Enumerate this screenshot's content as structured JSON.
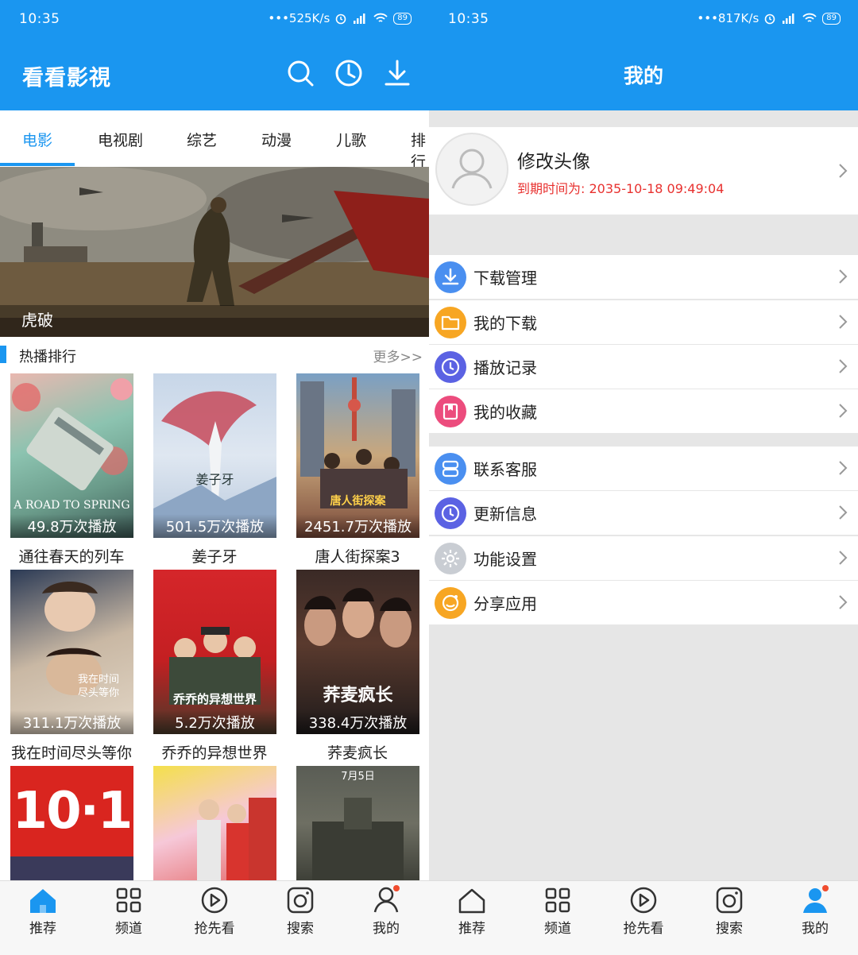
{
  "left": {
    "status": {
      "time": "10:35",
      "speed": "525K/s",
      "battery": "89"
    },
    "app_title": "看看影視",
    "tabs": [
      "电影",
      "电视剧",
      "综艺",
      "动漫",
      "儿歌",
      "排行"
    ],
    "active_tab": "电影",
    "banner": {
      "caption": "虎破"
    },
    "section": {
      "title": "热播排行",
      "more": "更多>>"
    },
    "posters": [
      {
        "title": "通往春天的列车",
        "count": "49.8万次播放",
        "poster_text": "A ROAD TO SPRING"
      },
      {
        "title": "姜子牙",
        "count": "501.5万次播放",
        "poster_text": "姜子牙"
      },
      {
        "title": "唐人街探案3",
        "count": "2451.7万次播放",
        "poster_text": "唐人街探案"
      },
      {
        "title": "我在时间尽头等你",
        "count": "311.1万次播放",
        "poster_text": "我在时间尽头等你"
      },
      {
        "title": "乔乔的异想世界",
        "count": "5.2万次播放",
        "poster_text": "乔乔的异想世界"
      },
      {
        "title": "荞麦疯长",
        "count": "338.4万次播放",
        "poster_text": "荞麦疯长"
      },
      {
        "title": "",
        "count": "",
        "poster_text": "10·1"
      },
      {
        "title": "",
        "count": "",
        "poster_text": ""
      },
      {
        "title": "",
        "count": "",
        "poster_text": "7月5日"
      }
    ],
    "nav": [
      {
        "label": "推荐",
        "icon": "home-icon",
        "active": true
      },
      {
        "label": "频道",
        "icon": "grid-icon",
        "active": false
      },
      {
        "label": "抢先看",
        "icon": "play-circle-icon",
        "active": false
      },
      {
        "label": "搜索",
        "icon": "camera-icon",
        "active": false
      },
      {
        "label": "我的",
        "icon": "user-icon",
        "active": false
      }
    ]
  },
  "right": {
    "status": {
      "time": "10:35",
      "speed": "817K/s",
      "battery": "89"
    },
    "page_title": "我的",
    "profile": {
      "name": "修改头像",
      "expire": "到期时间为: 2035-10-18 09:49:04"
    },
    "menu_group1": [
      {
        "label": "下载管理",
        "icon": "download-icon",
        "color": "#4a8ff0"
      },
      {
        "label": "我的下载",
        "icon": "folder-icon",
        "color": "#f7a623"
      },
      {
        "label": "播放记录",
        "icon": "clock-icon",
        "color": "#5b62e3"
      },
      {
        "label": "我的收藏",
        "icon": "bookmark-icon",
        "color": "#ec4c7d"
      }
    ],
    "menu_group2": [
      {
        "label": "联系客服",
        "icon": "server-icon",
        "color": "#4a8ff0"
      },
      {
        "label": "更新信息",
        "icon": "clock-icon",
        "color": "#5b62e3"
      },
      {
        "label": "功能设置",
        "icon": "gear-icon",
        "color": "#c9cdd3"
      },
      {
        "label": "分享应用",
        "icon": "share-icon",
        "color": "#f7a623"
      }
    ],
    "nav": [
      {
        "label": "推荐",
        "icon": "home-icon",
        "active": false
      },
      {
        "label": "频道",
        "icon": "grid-icon",
        "active": false
      },
      {
        "label": "抢先看",
        "icon": "play-circle-icon",
        "active": false
      },
      {
        "label": "搜索",
        "icon": "camera-icon",
        "active": false
      },
      {
        "label": "我的",
        "icon": "user-icon",
        "active": true
      }
    ]
  },
  "colors": {
    "primary": "#1a96f0",
    "expire": "#e8312f",
    "badge": "#f04c2e"
  }
}
